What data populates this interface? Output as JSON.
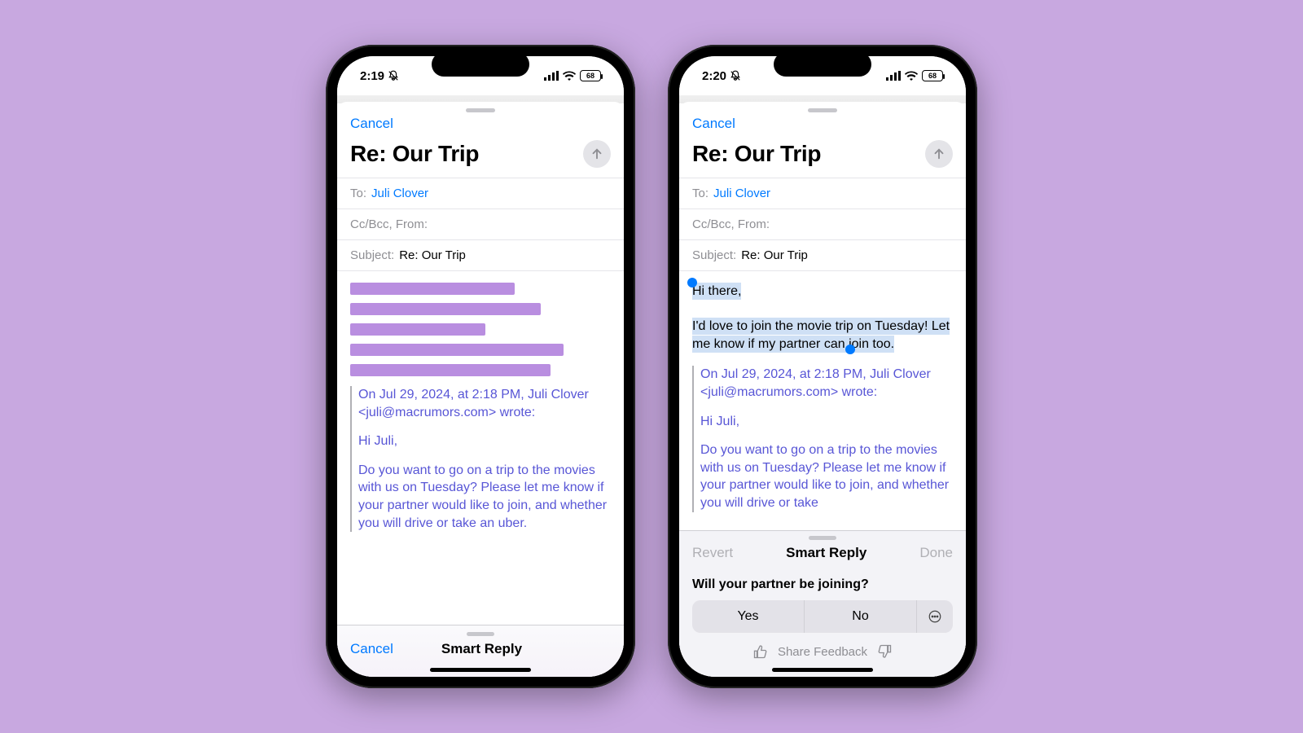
{
  "bg_color": "#c8a8e0",
  "accent_color": "#007aff",
  "quote_color": "#5856d6",
  "phone1": {
    "statusbar": {
      "time": "2:19",
      "battery": "68"
    },
    "cancel": "Cancel",
    "title": "Re: Our Trip",
    "to_label": "To:",
    "to_value": "Juli Clover",
    "cc_label": "Cc/Bcc, From:",
    "subject_label": "Subject:",
    "subject_value": "Re: Our Trip",
    "quote_attrib": "On Jul 29, 2024, at 2:18 PM, Juli Clover <juli@macrumors.com> wrote:",
    "quote_greeting": "Hi Juli,",
    "quote_body": "Do you want to go on a trip to the movies with us on Tuesday? Please let me know if your partner would like to join, and whether you will drive or take an uber.",
    "bottom_cancel": "Cancel",
    "bottom_title": "Smart Reply"
  },
  "phone2": {
    "statusbar": {
      "time": "2:20",
      "battery": "68"
    },
    "cancel": "Cancel",
    "title": "Re: Our Trip",
    "to_label": "To:",
    "to_value": "Juli Clover",
    "cc_label": "Cc/Bcc, From:",
    "subject_label": "Subject:",
    "subject_value": "Re: Our Trip",
    "reply_greeting": "Hi there,",
    "reply_body": "I'd love to join the movie trip on Tuesday! Let me know if my partner can join too.",
    "quote_attrib": "On Jul 29, 2024, at 2:18 PM, Juli Clover <juli@macrumors.com> wrote:",
    "quote_greeting": "Hi Juli,",
    "quote_body": "Do you want to go on a trip to the movies with us on Tuesday? Please let me know if your partner would like to join, and whether you will drive or take",
    "smart": {
      "revert": "Revert",
      "title": "Smart Reply",
      "done": "Done",
      "question": "Will your partner be joining?",
      "yes": "Yes",
      "no": "No",
      "feedback": "Share Feedback"
    }
  }
}
